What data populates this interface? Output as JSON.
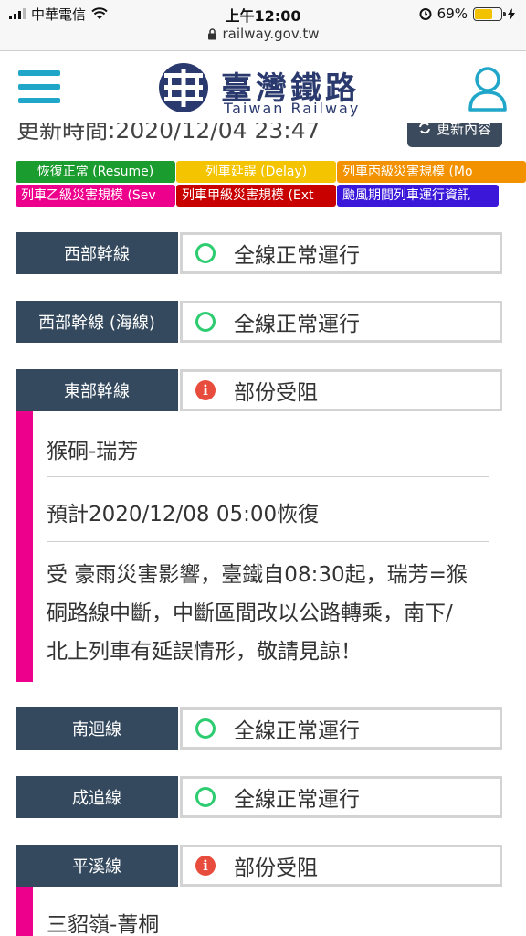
{
  "status_bar": {
    "carrier": "中華電信",
    "time": "上午12:00",
    "battery": "69%",
    "battery_level": 0.69,
    "url": "railway.gov.tw"
  },
  "header": {
    "logo_cn": "臺灣鐵路",
    "logo_en": "Taiwan Railway",
    "menu_icon": "hamburger-menu-icon",
    "user_icon": "user-icon",
    "brand_color": "#1fa6c9"
  },
  "update": {
    "text": "更新時間:2020/12/04 23:47",
    "button_label": "更新內容"
  },
  "legend": [
    {
      "label": "恢復正常 (Resume)",
      "color": "#1a9c2e"
    },
    {
      "label": "列車延誤 (Delay)",
      "color": "#f5c400"
    },
    {
      "label": "列車丙級災害規模 (Mo",
      "color": "#f39200"
    },
    {
      "label": "列車乙級災害規模 (Sev",
      "color": "#ec008c"
    },
    {
      "label": "列車甲級災害規模 (Ext",
      "color": "#c80000"
    },
    {
      "label": "颱風期間列車運行資訊",
      "color": "#3b17d9"
    }
  ],
  "lines": [
    {
      "name": "西部幹線",
      "status": "全線正常運行",
      "state": "normal"
    },
    {
      "name": "西部幹線 (海線)",
      "status": "全線正常運行",
      "state": "normal"
    },
    {
      "name": "東部幹線",
      "status": "部份受阻",
      "state": "disrupted",
      "detail": {
        "section": "猴硐-瑞芳",
        "eta": "預計2020/12/08 05:00恢復",
        "description_lines": [
          "受 豪雨災害影響，臺鐵自08:30起，瑞芳=猴",
          "硐路線中斷，中斷區間改以公路轉乘，南下/",
          "北上列車有延誤情形，敬請見諒！"
        ]
      }
    },
    {
      "name": "南迴線",
      "status": "全線正常運行",
      "state": "normal"
    },
    {
      "name": "成追線",
      "status": "全線正常運行",
      "state": "normal"
    },
    {
      "name": "平溪線",
      "status": "部份受阻",
      "state": "disrupted",
      "detail": {
        "section": "三貂嶺-菁桐"
      }
    }
  ]
}
